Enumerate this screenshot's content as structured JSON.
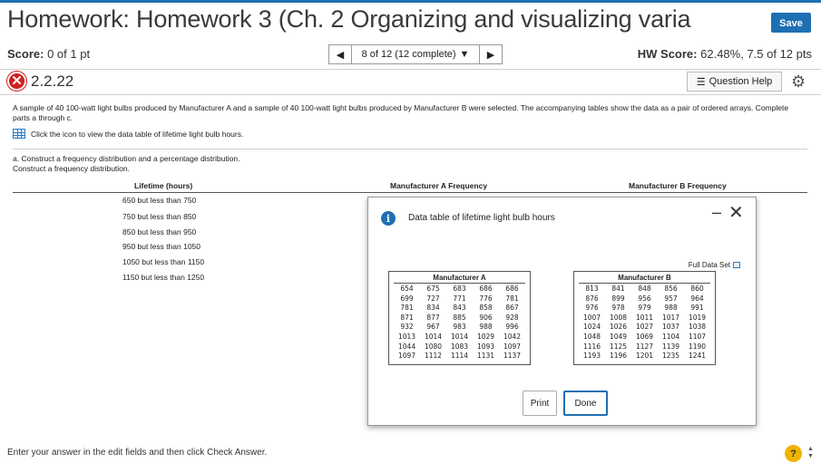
{
  "header": {
    "title": "Homework: Homework 3 (Ch. 2 Organizing and visualizing varia",
    "save_label": "Save"
  },
  "score_bar": {
    "score_label": "Score:",
    "score_value": "0 of 1 pt",
    "nav_text": "8 of 12 (12 complete)",
    "hw_score_label": "HW Score:",
    "hw_score_value": "62.48%, 7.5 of 12 pts"
  },
  "question": {
    "number": "2.2.22",
    "help_label": "Question Help",
    "prompt": "A sample of 40 100-watt light bulbs produced by Manufacturer A and a sample of 40 100-watt light bulbs produced by Manufacturer B were selected. The accompanying tables show the data as a pair of ordered arrays. Complete parts a through c.",
    "icon_text": "Click the icon to view the data table of lifetime light bulb hours.",
    "part_a_line1": "a. Construct a frequency distribution and a percentage distribution.",
    "part_a_line2": "Construct a frequency distribution."
  },
  "freq_table": {
    "col_lifetime": "Lifetime (hours)",
    "col_a": "Manufacturer A Frequency",
    "col_b": "Manufacturer B Frequency",
    "rows": [
      "650 but less than 750",
      "750 but less than 850",
      "850 but less than 950",
      "950 but less than 1050",
      "1050 but less than 1150",
      "1150 but less than 1250"
    ]
  },
  "dialog": {
    "title": "Data table of lifetime light bulb hours",
    "full_data_label": "Full Data Set",
    "manufacturer_a": {
      "name": "Manufacturer A",
      "rows": [
        [
          "654",
          "675",
          "683",
          "686",
          "686"
        ],
        [
          "699",
          "727",
          "771",
          "776",
          "781"
        ],
        [
          "781",
          "834",
          "843",
          "858",
          "867"
        ],
        [
          "871",
          "877",
          "885",
          "906",
          "928"
        ],
        [
          "932",
          "967",
          "983",
          "988",
          "996"
        ],
        [
          "1013",
          "1014",
          "1014",
          "1029",
          "1042"
        ],
        [
          "1044",
          "1080",
          "1083",
          "1093",
          "1097"
        ],
        [
          "1097",
          "1112",
          "1114",
          "1131",
          "1137"
        ]
      ]
    },
    "manufacturer_b": {
      "name": "Manufacturer B",
      "rows": [
        [
          "813",
          "841",
          "848",
          "856",
          "860"
        ],
        [
          "876",
          "899",
          "956",
          "957",
          "964"
        ],
        [
          "976",
          "978",
          "979",
          "988",
          "991"
        ],
        [
          "1007",
          "1008",
          "1011",
          "1017",
          "1019"
        ],
        [
          "1024",
          "1026",
          "1027",
          "1037",
          "1038"
        ],
        [
          "1048",
          "1049",
          "1069",
          "1104",
          "1107"
        ],
        [
          "1116",
          "1125",
          "1127",
          "1139",
          "1190"
        ],
        [
          "1193",
          "1196",
          "1201",
          "1235",
          "1241"
        ]
      ]
    },
    "print_label": "Print",
    "done_label": "Done"
  },
  "footer": {
    "text": "Enter your answer in the edit fields and then click Check Answer.",
    "help_symbol": "?"
  }
}
